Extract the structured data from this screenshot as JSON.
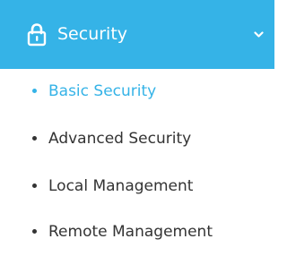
{
  "nav": {
    "section": {
      "title": "Security",
      "icon": "lock-icon",
      "expand_icon": "chevron-down-icon",
      "background_color": "#35b3e7",
      "text_color": "#ffffff"
    },
    "items": [
      {
        "label": "Basic Security",
        "active": true
      },
      {
        "label": "Advanced Security",
        "active": false
      },
      {
        "label": "Local Management",
        "active": false
      },
      {
        "label": "Remote Management",
        "active": false
      }
    ],
    "active_color": "#35b3e7",
    "text_color": "#333333"
  }
}
